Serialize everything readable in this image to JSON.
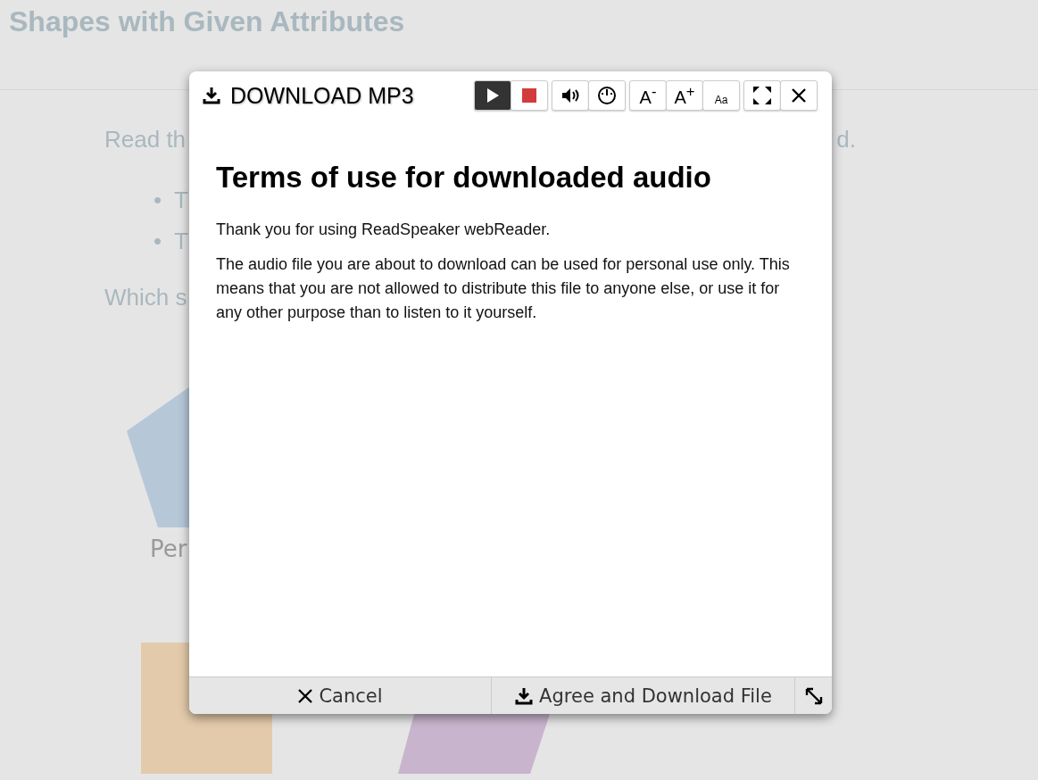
{
  "page": {
    "title": "Shapes with Given Attributes",
    "intro_start": "Read th",
    "intro_end": "d.",
    "bullets": [
      {
        "marker": "•",
        "text": "T"
      },
      {
        "marker": "•",
        "text": "T"
      }
    ],
    "question": "Which s",
    "shape_label": "Per"
  },
  "dialog": {
    "title": "DOWNLOAD MP3",
    "tool_groups": [
      [
        {
          "kind": "play",
          "pressed": true
        },
        {
          "kind": "stop",
          "pressed": false
        }
      ],
      [
        {
          "kind": "volume",
          "pressed": false
        },
        {
          "kind": "speed",
          "pressed": false
        }
      ],
      [
        {
          "kind": "text",
          "label": "A$^{-}$",
          "pressed": false
        },
        {
          "kind": "text",
          "label": "A$^{+}$",
          "pressed": false
        },
        {
          "kind": "textsettings",
          "label": "Aa",
          "pressed": false
        }
      ],
      [
        {
          "kind": "maximize",
          "pressed": false
        },
        {
          "kind": "close",
          "pressed": false
        }
      ]
    ],
    "heading": "Terms of use for downloaded audio",
    "paragraphs": [
      "Thank you for using ReadSpeaker webReader.",
      "The audio file you are about to download can be used for personal use only. This means that you are not allowed to distribute this file to anyone else, or use it for any other purpose than to listen to it yourself."
    ],
    "cancel": "Cancel",
    "agree": "Agree and Download File"
  }
}
